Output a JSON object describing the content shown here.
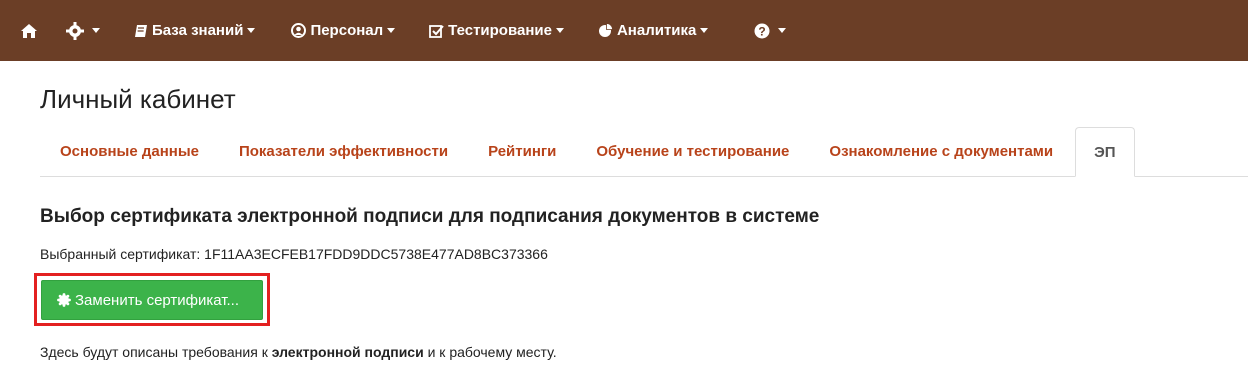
{
  "navbar": {
    "items": [
      {
        "icon": "home-icon",
        "label": "",
        "has_caret": false
      },
      {
        "icon": "gear-icon",
        "label": "",
        "has_caret": true
      },
      {
        "icon": "book-icon",
        "label": "База знаний",
        "has_caret": true
      },
      {
        "icon": "user-icon",
        "label": "Персонал",
        "has_caret": true
      },
      {
        "icon": "checkbox-icon",
        "label": "Тестирование",
        "has_caret": true
      },
      {
        "icon": "pie-chart-icon",
        "label": "Аналитика",
        "has_caret": true
      },
      {
        "icon": "question-icon",
        "label": "",
        "has_caret": true
      }
    ],
    "bg_color": "#6b3e26"
  },
  "page": {
    "title": "Личный кабинет"
  },
  "tabs": [
    {
      "label": "Основные данные",
      "active": false
    },
    {
      "label": "Показатели эффективности",
      "active": false
    },
    {
      "label": "Рейтинги",
      "active": false
    },
    {
      "label": "Обучение и тестирование",
      "active": false
    },
    {
      "label": "Ознакомление с документами",
      "active": false
    },
    {
      "label": "ЭП",
      "active": true
    }
  ],
  "signature": {
    "title": "Выбор сертификата электронной подписи для подписания документов в системе",
    "selected_label": "Выбранный сертификат:",
    "selected_value": "1F11AA3ECFEB17FDD9DDC5738E477AD8BC373366",
    "replace_button": "Заменить сертификат...",
    "note_before": "Здесь будут описаны требования к ",
    "note_bold": "электронной подписи",
    "note_after": " и к рабочему месту."
  },
  "colors": {
    "tab_link": "#b8431a",
    "button_green": "#3cb34a",
    "highlight_red": "#e32020"
  }
}
